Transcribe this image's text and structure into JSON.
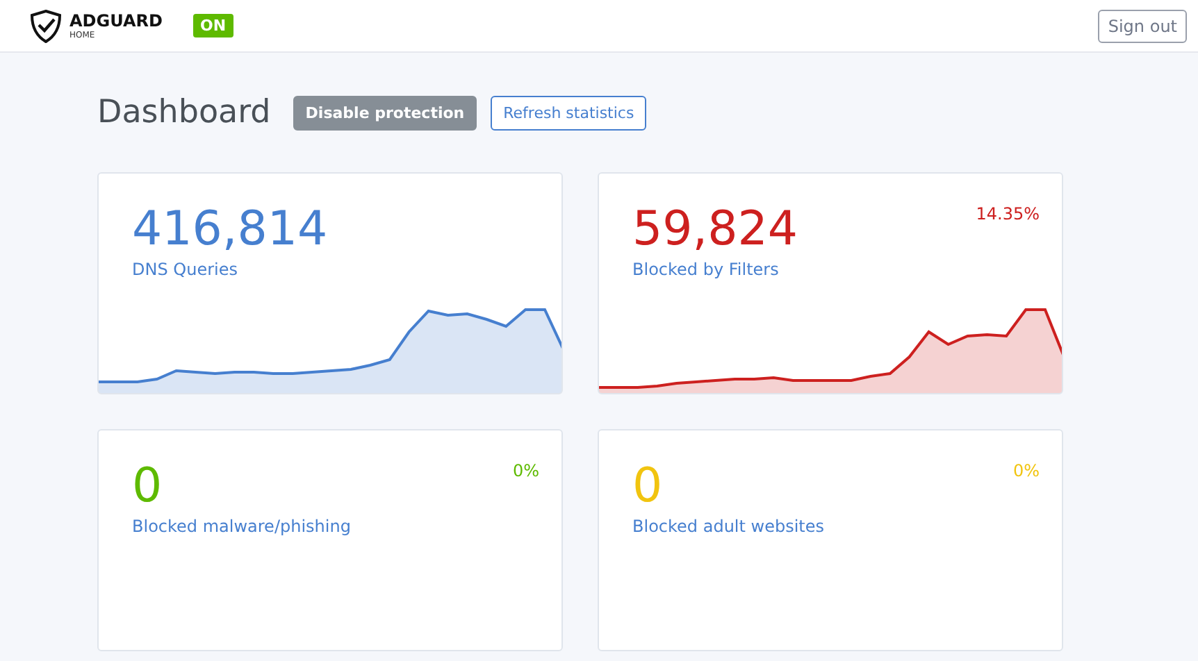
{
  "header": {
    "brand": "ADGUARD",
    "subtitle": "HOME",
    "status": "ON",
    "sign_out": "Sign out"
  },
  "page": {
    "title": "Dashboard",
    "buttons": [
      {
        "label": "Disable protection",
        "kind": "solid"
      },
      {
        "label": "Refresh statistics",
        "kind": "outline"
      }
    ]
  },
  "cards": [
    {
      "value": "416,814",
      "label": "DNS Queries",
      "color": "#467fcf",
      "kind": "sparkline"
    },
    {
      "value": "59,824",
      "label": "Blocked by Filters",
      "color": "#cd201f",
      "percent": "14.35%",
      "kind": "sparkline"
    },
    {
      "value": "0",
      "label": "Blocked malware/phishing",
      "color": "#5eba00",
      "percent": "0%",
      "kind": "plain"
    },
    {
      "value": "0",
      "label": "Blocked adult websites",
      "color": "#f1c40f",
      "percent": "0%",
      "kind": "plain"
    }
  ]
}
